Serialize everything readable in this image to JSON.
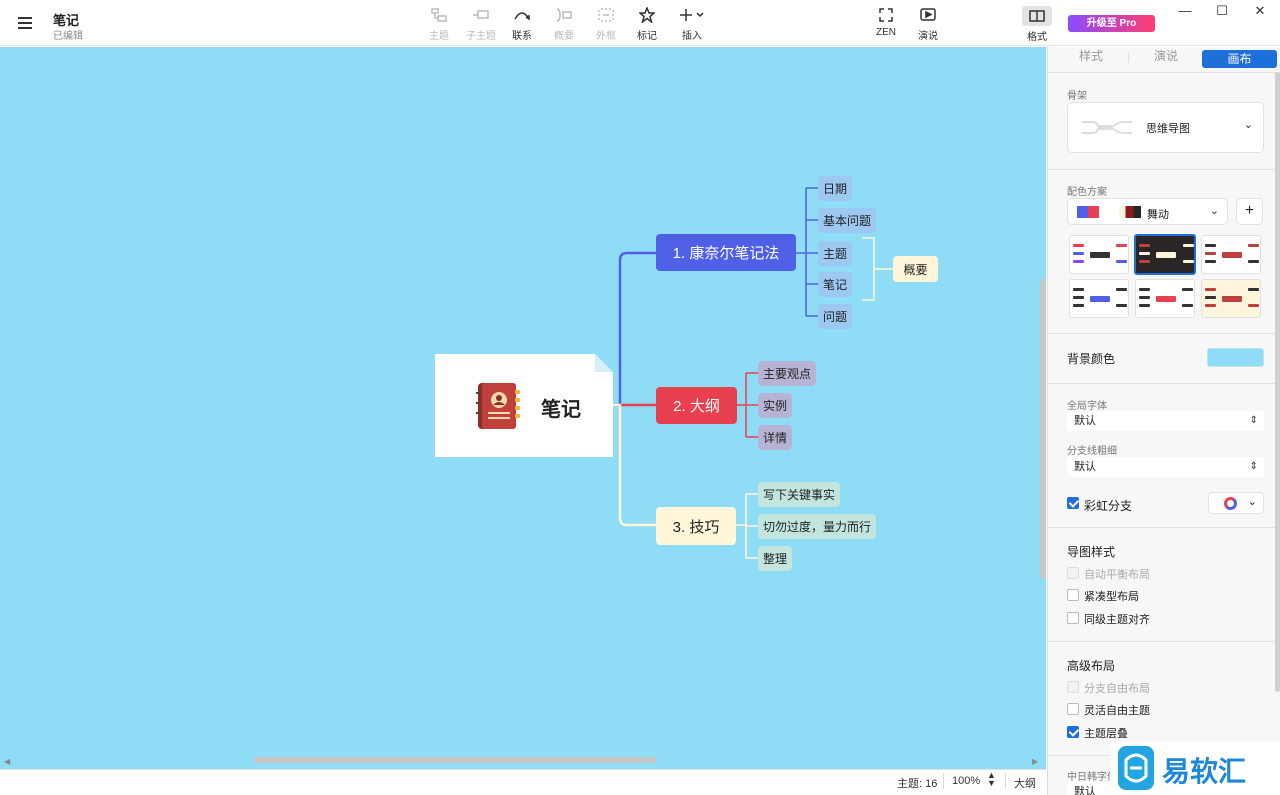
{
  "app": {
    "doc_title": "笔记",
    "doc_status": "已编辑",
    "upgrade_label": "升级至 Pro",
    "format_label": "格式",
    "window_controls": {
      "minimize": "—",
      "maximize": "☐",
      "close": "✕"
    }
  },
  "toolbar": {
    "topic": "主题",
    "subtopic": "子主题",
    "relation": "联系",
    "summary": "概要",
    "boundary": "外框",
    "marker": "标记",
    "insert": "插入",
    "zen": "ZEN",
    "present": "演说"
  },
  "mindmap": {
    "central": "笔记",
    "branches": [
      {
        "label": "1. 康奈尔笔记法",
        "color": "#4f60e6",
        "children": [
          "日期",
          "基本问题",
          "主题",
          "笔记",
          "问题"
        ],
        "summary": "概要"
      },
      {
        "label": "2. 大纲",
        "color": "#e8404f",
        "children": [
          "主要观点",
          "实例",
          "详情"
        ]
      },
      {
        "label": "3. 技巧",
        "color": "#fff6d9",
        "children": [
          "写下关键事实",
          "切勿过度，量力而行",
          "整理"
        ]
      }
    ]
  },
  "status_bar": {
    "topic_count": "主题: 16",
    "zoom": "100%",
    "outline": "大纲"
  },
  "panel": {
    "tabs": [
      "样式",
      "演说",
      "画布"
    ],
    "active_tab": "画布",
    "skeleton_label": "骨架",
    "skeleton_value": "思维导图",
    "scheme_label": "配色方案",
    "scheme_value": "舞动",
    "add": "+",
    "bg_color_label": "背景颜色",
    "bg_color": "#8fdcf6",
    "global_font_label": "全局字体",
    "global_font_value": "默认",
    "branch_width_label": "分支线粗细",
    "branch_width_value": "默认",
    "rainbow_label": "彩虹分支",
    "map_style_label": "导图样式",
    "auto_balance": "自动平衡布局",
    "compact": "紧凑型布局",
    "align_same": "同级主题对齐",
    "advanced_label": "高级布局",
    "free_branch": "分支自由布局",
    "flexible_free": "灵活自由主题",
    "overlap": "主题层叠",
    "cjk_font_label": "中日韩字体",
    "cjk_font_value": "默认"
  },
  "watermark": "易软汇"
}
